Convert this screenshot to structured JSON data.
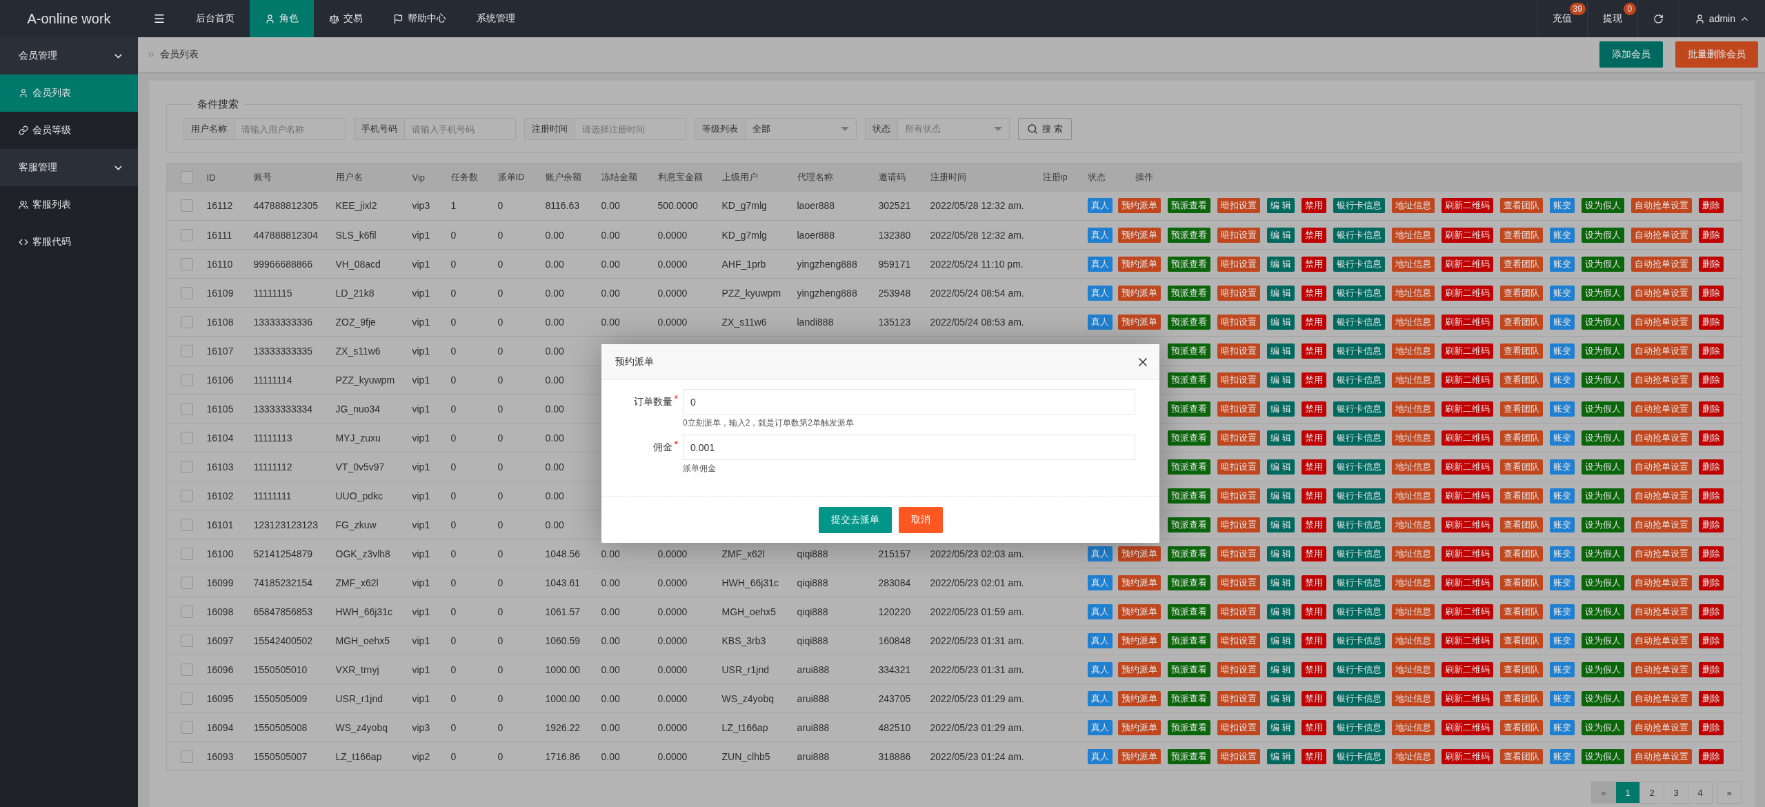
{
  "app": {
    "title": "A-online work"
  },
  "top_nav": [
    {
      "label": "后台首页",
      "selected": false
    },
    {
      "label": "角色",
      "selected": true
    },
    {
      "label": "交易",
      "selected": false
    },
    {
      "label": "帮助中心",
      "selected": false
    },
    {
      "label": "系统管理",
      "selected": false
    }
  ],
  "top_right": [
    {
      "label": "充值",
      "badge": "39"
    },
    {
      "label": "提现",
      "badge": "0"
    }
  ],
  "user": {
    "name": "admin"
  },
  "sidebar": [
    {
      "label": "会员管理",
      "expanded": true,
      "children": [
        {
          "label": "会员列表",
          "selected": true
        },
        {
          "label": "会员等级",
          "selected": false
        }
      ]
    },
    {
      "label": "客服管理",
      "expanded": true,
      "children": [
        {
          "label": "客服列表",
          "selected": false
        },
        {
          "label": "客服代码",
          "selected": false
        }
      ]
    }
  ],
  "breadcrumb": "会员列表",
  "page_actions": [
    {
      "label": "添加会员",
      "kind": "primary"
    },
    {
      "label": "批量删除会员",
      "kind": "danger"
    }
  ],
  "search": {
    "legend": "条件搜索",
    "fields": [
      {
        "label": "用户名称",
        "kind": "input",
        "placeholder": "请输入用户名称"
      },
      {
        "label": "手机号码",
        "kind": "input",
        "placeholder": "请输入手机号码"
      },
      {
        "label": "注册时间",
        "kind": "input",
        "placeholder": "请选择注册时间"
      },
      {
        "label": "等级列表",
        "kind": "select",
        "value": "全部"
      },
      {
        "label": "状态",
        "kind": "select",
        "placeholder": "所有状态"
      }
    ],
    "button": "搜 索"
  },
  "table": {
    "select_all": {
      "checked": false
    },
    "columns": [
      "ID",
      "账号",
      "用户名",
      "Vip",
      "任务数",
      "派单ID",
      "账户余额",
      "冻结金额",
      "利息宝金额",
      "上级用户",
      "代理名称",
      "邀请码",
      "注册时间",
      "注册ip",
      "状态",
      "操作"
    ],
    "rows": [
      {
        "checked": false,
        "cells": [
          "16112",
          "447888812305",
          "KEE_jixl2",
          "vip3",
          "1",
          "0",
          "8116.63",
          "0.00",
          "500.0000",
          "KD_g7mlg",
          "laoer888",
          "302521",
          "2022/05/28 12:32 am."
        ],
        "status": "真人",
        "actions": [
          {
            "label": "预约派单",
            "color": "#c0461e"
          },
          {
            "label": "预派查看",
            "color": "#0b650b"
          },
          {
            "label": "暗扣设置",
            "color": "#c0461e"
          },
          {
            "label": "编 辑",
            "color": "#00695f"
          },
          {
            "label": "禁用",
            "color": "#c00000"
          },
          {
            "label": "银行卡信息",
            "color": "#00695f"
          },
          {
            "label": "地址信息",
            "color": "#c0461e"
          },
          {
            "label": "刷新二维码",
            "color": "#c00000"
          },
          {
            "label": "查看团队",
            "color": "#c0461e"
          },
          {
            "label": "账变",
            "color": "#1f7fd0"
          },
          {
            "label": "设为假人",
            "color": "#0b650b"
          },
          {
            "label": "自动抢单设置",
            "color": "#c0461e"
          },
          {
            "label": "删除",
            "color": "#c00000"
          }
        ]
      },
      {
        "checked": false,
        "cells": [
          "16111",
          "447888812304",
          "SLS_k6fil",
          "vip1",
          "0",
          "0",
          "0.00",
          "0.00",
          "0.0000",
          "KD_g7mlg",
          "laoer888",
          "132380",
          "2022/05/28 12:32 am."
        ],
        "status": "真人",
        "actions": [
          {
            "label": "预约派单",
            "color": "#c0461e"
          },
          {
            "label": "预派查看",
            "color": "#0b650b"
          },
          {
            "label": "暗扣设置",
            "color": "#c0461e"
          },
          {
            "label": "编 辑",
            "color": "#00695f"
          },
          {
            "label": "禁用",
            "color": "#c00000"
          },
          {
            "label": "银行卡信息",
            "color": "#00695f"
          },
          {
            "label": "地址信息",
            "color": "#c0461e"
          },
          {
            "label": "刷新二维码",
            "color": "#c00000"
          },
          {
            "label": "查看团队",
            "color": "#c0461e"
          },
          {
            "label": "账变",
            "color": "#1f7fd0"
          },
          {
            "label": "设为假人",
            "color": "#0b650b"
          },
          {
            "label": "自动抢单设置",
            "color": "#c0461e"
          },
          {
            "label": "删除",
            "color": "#c00000"
          }
        ]
      },
      {
        "checked": false,
        "cells": [
          "16110",
          "99966688866",
          "VH_08acd",
          "vip1",
          "0",
          "0",
          "0.00",
          "0.00",
          "0.0000",
          "AHF_1prb",
          "yingzheng888",
          "959171",
          "2022/05/24 11:10 pm."
        ],
        "status": "真人",
        "actions": [
          {
            "label": "预约派单",
            "color": "#c0461e"
          },
          {
            "label": "预派查看",
            "color": "#0b650b"
          },
          {
            "label": "暗扣设置",
            "color": "#c0461e"
          },
          {
            "label": "编 辑",
            "color": "#00695f"
          },
          {
            "label": "禁用",
            "color": "#c00000"
          },
          {
            "label": "银行卡信息",
            "color": "#00695f"
          },
          {
            "label": "地址信息",
            "color": "#c0461e"
          },
          {
            "label": "刷新二维码",
            "color": "#c00000"
          },
          {
            "label": "查看团队",
            "color": "#c0461e"
          },
          {
            "label": "账变",
            "color": "#1f7fd0"
          },
          {
            "label": "设为假人",
            "color": "#0b650b"
          },
          {
            "label": "自动抢单设置",
            "color": "#c0461e"
          },
          {
            "label": "删除",
            "color": "#c00000"
          }
        ]
      },
      {
        "checked": false,
        "cells": [
          "16109",
          "11111115",
          "LD_21k8",
          "vip1",
          "0",
          "0",
          "0.00",
          "0.00",
          "0.0000",
          "PZZ_kyuwpm",
          "yingzheng888",
          "253948",
          "2022/05/24 08:54 am."
        ],
        "status": "真人",
        "actions": [
          {
            "label": "预约派单",
            "color": "#c0461e"
          },
          {
            "label": "预派查看",
            "color": "#0b650b"
          },
          {
            "label": "暗扣设置",
            "color": "#c0461e"
          },
          {
            "label": "编 辑",
            "color": "#00695f"
          },
          {
            "label": "禁用",
            "color": "#c00000"
          },
          {
            "label": "银行卡信息",
            "color": "#00695f"
          },
          {
            "label": "地址信息",
            "color": "#c0461e"
          },
          {
            "label": "刷新二维码",
            "color": "#c00000"
          },
          {
            "label": "查看团队",
            "color": "#c0461e"
          },
          {
            "label": "账变",
            "color": "#1f7fd0"
          },
          {
            "label": "设为假人",
            "color": "#0b650b"
          },
          {
            "label": "自动抢单设置",
            "color": "#c0461e"
          },
          {
            "label": "删除",
            "color": "#c00000"
          }
        ]
      },
      {
        "checked": false,
        "cells": [
          "16108",
          "13333333336",
          "ZOZ_9fje",
          "vip1",
          "0",
          "0",
          "0.00",
          "0.00",
          "0.0000",
          "ZX_s11w6",
          "landi888",
          "135123",
          "2022/05/24 08:53 am."
        ],
        "status": "真人",
        "actions": [
          {
            "label": "预约派单",
            "color": "#c0461e"
          },
          {
            "label": "预派查看",
            "color": "#0b650b"
          },
          {
            "label": "暗扣设置",
            "color": "#c0461e"
          },
          {
            "label": "编 辑",
            "color": "#00695f"
          },
          {
            "label": "禁用",
            "color": "#c00000"
          },
          {
            "label": "银行卡信息",
            "color": "#00695f"
          },
          {
            "label": "地址信息",
            "color": "#c0461e"
          },
          {
            "label": "刷新二维码",
            "color": "#c00000"
          },
          {
            "label": "查看团队",
            "color": "#c0461e"
          },
          {
            "label": "账变",
            "color": "#1f7fd0"
          },
          {
            "label": "设为假人",
            "color": "#0b650b"
          },
          {
            "label": "自动抢单设置",
            "color": "#c0461e"
          },
          {
            "label": "删除",
            "color": "#c00000"
          }
        ]
      },
      {
        "checked": false,
        "cells": [
          "16107",
          "13333333335",
          "ZX_s11w6",
          "vip1",
          "0",
          "0",
          "0.00"
        ],
        "actions": [
          {
            "label": "预派查看",
            "color": "#0b650b"
          },
          {
            "label": "暗扣设置",
            "color": "#c0461e"
          },
          {
            "label": "编 辑",
            "color": "#00695f"
          },
          {
            "label": "禁用",
            "color": "#c00000"
          },
          {
            "label": "银行卡信息",
            "color": "#00695f"
          },
          {
            "label": "地址信息",
            "color": "#c0461e"
          },
          {
            "label": "刷新二维码",
            "color": "#c00000"
          },
          {
            "label": "查看团队",
            "color": "#c0461e"
          },
          {
            "label": "账变",
            "color": "#1f7fd0"
          },
          {
            "label": "设为假人",
            "color": "#0b650b"
          },
          {
            "label": "自动抢单设置",
            "color": "#c0461e"
          },
          {
            "label": "删除",
            "color": "#c00000"
          }
        ]
      },
      {
        "checked": false,
        "cells": [
          "16106",
          "11111114",
          "PZZ_kyuwpm",
          "vip1",
          "0",
          "0",
          "0.00"
        ],
        "actions": [
          {
            "label": "预派查看",
            "color": "#0b650b"
          },
          {
            "label": "暗扣设置",
            "color": "#c0461e"
          },
          {
            "label": "编 辑",
            "color": "#00695f"
          },
          {
            "label": "禁用",
            "color": "#c00000"
          },
          {
            "label": "银行卡信息",
            "color": "#00695f"
          },
          {
            "label": "地址信息",
            "color": "#c0461e"
          },
          {
            "label": "刷新二维码",
            "color": "#c00000"
          },
          {
            "label": "查看团队",
            "color": "#c0461e"
          },
          {
            "label": "账变",
            "color": "#1f7fd0"
          },
          {
            "label": "设为假人",
            "color": "#0b650b"
          },
          {
            "label": "自动抢单设置",
            "color": "#c0461e"
          },
          {
            "label": "删除",
            "color": "#c00000"
          }
        ]
      },
      {
        "checked": false,
        "cells": [
          "16105",
          "13333333334",
          "JG_nuo34",
          "vip1",
          "0",
          "0",
          "0.00"
        ],
        "actions": [
          {
            "label": "预派查看",
            "color": "#0b650b"
          },
          {
            "label": "暗扣设置",
            "color": "#c0461e"
          },
          {
            "label": "编 辑",
            "color": "#00695f"
          },
          {
            "label": "禁用",
            "color": "#c00000"
          },
          {
            "label": "银行卡信息",
            "color": "#00695f"
          },
          {
            "label": "地址信息",
            "color": "#c0461e"
          },
          {
            "label": "刷新二维码",
            "color": "#c00000"
          },
          {
            "label": "查看团队",
            "color": "#c0461e"
          },
          {
            "label": "账变",
            "color": "#1f7fd0"
          },
          {
            "label": "设为假人",
            "color": "#0b650b"
          },
          {
            "label": "自动抢单设置",
            "color": "#c0461e"
          },
          {
            "label": "删除",
            "color": "#c00000"
          }
        ]
      },
      {
        "checked": false,
        "cells": [
          "16104",
          "11111113",
          "MYJ_zuxu",
          "vip1",
          "0",
          "0",
          "0.00"
        ],
        "actions": [
          {
            "label": "预派查看",
            "color": "#0b650b"
          },
          {
            "label": "暗扣设置",
            "color": "#c0461e"
          },
          {
            "label": "编 辑",
            "color": "#00695f"
          },
          {
            "label": "禁用",
            "color": "#c00000"
          },
          {
            "label": "银行卡信息",
            "color": "#00695f"
          },
          {
            "label": "地址信息",
            "color": "#c0461e"
          },
          {
            "label": "刷新二维码",
            "color": "#c00000"
          },
          {
            "label": "查看团队",
            "color": "#c0461e"
          },
          {
            "label": "账变",
            "color": "#1f7fd0"
          },
          {
            "label": "设为假人",
            "color": "#0b650b"
          },
          {
            "label": "自动抢单设置",
            "color": "#c0461e"
          },
          {
            "label": "删除",
            "color": "#c00000"
          }
        ]
      },
      {
        "checked": false,
        "cells": [
          "16103",
          "11111112",
          "VT_0v5v97",
          "vip1",
          "0",
          "0",
          "0.00"
        ],
        "actions": [
          {
            "label": "预派查看",
            "color": "#0b650b"
          },
          {
            "label": "暗扣设置",
            "color": "#c0461e"
          },
          {
            "label": "编 辑",
            "color": "#00695f"
          },
          {
            "label": "禁用",
            "color": "#c00000"
          },
          {
            "label": "银行卡信息",
            "color": "#00695f"
          },
          {
            "label": "地址信息",
            "color": "#c0461e"
          },
          {
            "label": "刷新二维码",
            "color": "#c00000"
          },
          {
            "label": "查看团队",
            "color": "#c0461e"
          },
          {
            "label": "账变",
            "color": "#1f7fd0"
          },
          {
            "label": "设为假人",
            "color": "#0b650b"
          },
          {
            "label": "自动抢单设置",
            "color": "#c0461e"
          },
          {
            "label": "删除",
            "color": "#c00000"
          }
        ]
      },
      {
        "checked": false,
        "cells": [
          "16102",
          "11111111",
          "UUO_pdkc",
          "vip1",
          "0",
          "0",
          "0.00"
        ],
        "actions": [
          {
            "label": "预派查看",
            "color": "#0b650b"
          },
          {
            "label": "暗扣设置",
            "color": "#c0461e"
          },
          {
            "label": "编 辑",
            "color": "#00695f"
          },
          {
            "label": "禁用",
            "color": "#c00000"
          },
          {
            "label": "银行卡信息",
            "color": "#00695f"
          },
          {
            "label": "地址信息",
            "color": "#c0461e"
          },
          {
            "label": "刷新二维码",
            "color": "#c00000"
          },
          {
            "label": "查看团队",
            "color": "#c0461e"
          },
          {
            "label": "账变",
            "color": "#1f7fd0"
          },
          {
            "label": "设为假人",
            "color": "#0b650b"
          },
          {
            "label": "自动抢单设置",
            "color": "#c0461e"
          },
          {
            "label": "删除",
            "color": "#c00000"
          }
        ]
      },
      {
        "checked": false,
        "cells": [
          "16101",
          "123123123123",
          "FG_zkuw",
          "vip1",
          "0",
          "0",
          "0.00"
        ],
        "actions": [
          {
            "label": "预派查看",
            "color": "#0b650b"
          },
          {
            "label": "暗扣设置",
            "color": "#c0461e"
          },
          {
            "label": "编 辑",
            "color": "#00695f"
          },
          {
            "label": "禁用",
            "color": "#c00000"
          },
          {
            "label": "银行卡信息",
            "color": "#00695f"
          },
          {
            "label": "地址信息",
            "color": "#c0461e"
          },
          {
            "label": "刷新二维码",
            "color": "#c00000"
          },
          {
            "label": "查看团队",
            "color": "#c0461e"
          },
          {
            "label": "账变",
            "color": "#1f7fd0"
          },
          {
            "label": "设为假人",
            "color": "#0b650b"
          },
          {
            "label": "自动抢单设置",
            "color": "#c0461e"
          },
          {
            "label": "删除",
            "color": "#c00000"
          }
        ]
      },
      {
        "checked": false,
        "cells": [
          "16100",
          "52141254879",
          "OGK_z3vlh8",
          "vip1",
          "0",
          "0",
          "1048.56",
          "0.00",
          "0.0000",
          "ZMF_x62l",
          "qiqi888",
          "215157",
          "2022/05/23 02:03 am."
        ],
        "status": "真人",
        "actions": [
          {
            "label": "预约派单",
            "color": "#c0461e"
          },
          {
            "label": "预派查看",
            "color": "#0b650b"
          },
          {
            "label": "暗扣设置",
            "color": "#c0461e"
          },
          {
            "label": "编 辑",
            "color": "#00695f"
          },
          {
            "label": "禁用",
            "color": "#c00000"
          },
          {
            "label": "银行卡信息",
            "color": "#00695f"
          },
          {
            "label": "地址信息",
            "color": "#c0461e"
          },
          {
            "label": "刷新二维码",
            "color": "#c00000"
          },
          {
            "label": "查看团队",
            "color": "#c0461e"
          },
          {
            "label": "账变",
            "color": "#1f7fd0"
          },
          {
            "label": "设为假人",
            "color": "#0b650b"
          },
          {
            "label": "自动抢单设置",
            "color": "#c0461e"
          },
          {
            "label": "删除",
            "color": "#c00000"
          }
        ]
      },
      {
        "checked": false,
        "cells": [
          "16099",
          "74185232154",
          "ZMF_x62l",
          "vip1",
          "0",
          "0",
          "1043.61",
          "0.00",
          "0.0000",
          "HWH_66j31c",
          "qiqi888",
          "283084",
          "2022/05/23 02:01 am."
        ],
        "status": "真人",
        "actions": [
          {
            "label": "预约派单",
            "color": "#c0461e"
          },
          {
            "label": "预派查看",
            "color": "#0b650b"
          },
          {
            "label": "暗扣设置",
            "color": "#c0461e"
          },
          {
            "label": "编 辑",
            "color": "#00695f"
          },
          {
            "label": "禁用",
            "color": "#c00000"
          },
          {
            "label": "银行卡信息",
            "color": "#00695f"
          },
          {
            "label": "地址信息",
            "color": "#c0461e"
          },
          {
            "label": "刷新二维码",
            "color": "#c00000"
          },
          {
            "label": "查看团队",
            "color": "#c0461e"
          },
          {
            "label": "账变",
            "color": "#1f7fd0"
          },
          {
            "label": "设为假人",
            "color": "#0b650b"
          },
          {
            "label": "自动抢单设置",
            "color": "#c0461e"
          },
          {
            "label": "删除",
            "color": "#c00000"
          }
        ]
      },
      {
        "checked": false,
        "cells": [
          "16098",
          "65847856853",
          "HWH_66j31c",
          "vip1",
          "0",
          "0",
          "1061.57",
          "0.00",
          "0.0000",
          "MGH_oehx5",
          "qiqi888",
          "120220",
          "2022/05/23 01:59 am."
        ],
        "status": "真人",
        "actions": [
          {
            "label": "预约派单",
            "color": "#c0461e"
          },
          {
            "label": "预派查看",
            "color": "#0b650b"
          },
          {
            "label": "暗扣设置",
            "color": "#c0461e"
          },
          {
            "label": "编 辑",
            "color": "#00695f"
          },
          {
            "label": "禁用",
            "color": "#c00000"
          },
          {
            "label": "银行卡信息",
            "color": "#00695f"
          },
          {
            "label": "地址信息",
            "color": "#c0461e"
          },
          {
            "label": "刷新二维码",
            "color": "#c00000"
          },
          {
            "label": "查看团队",
            "color": "#c0461e"
          },
          {
            "label": "账变",
            "color": "#1f7fd0"
          },
          {
            "label": "设为假人",
            "color": "#0b650b"
          },
          {
            "label": "自动抢单设置",
            "color": "#c0461e"
          },
          {
            "label": "删除",
            "color": "#c00000"
          }
        ]
      },
      {
        "checked": false,
        "cells": [
          "16097",
          "15542400502",
          "MGH_oehx5",
          "vip1",
          "0",
          "0",
          "1060.59",
          "0.00",
          "0.0000",
          "KBS_3rb3",
          "qiqi888",
          "160848",
          "2022/05/23 01:31 am."
        ],
        "status": "真人",
        "actions": [
          {
            "label": "预约派单",
            "color": "#c0461e"
          },
          {
            "label": "预派查看",
            "color": "#0b650b"
          },
          {
            "label": "暗扣设置",
            "color": "#c0461e"
          },
          {
            "label": "编 辑",
            "color": "#00695f"
          },
          {
            "label": "禁用",
            "color": "#c00000"
          },
          {
            "label": "银行卡信息",
            "color": "#00695f"
          },
          {
            "label": "地址信息",
            "color": "#c0461e"
          },
          {
            "label": "刷新二维码",
            "color": "#c00000"
          },
          {
            "label": "查看团队",
            "color": "#c0461e"
          },
          {
            "label": "账变",
            "color": "#1f7fd0"
          },
          {
            "label": "设为假人",
            "color": "#0b650b"
          },
          {
            "label": "自动抢单设置",
            "color": "#c0461e"
          },
          {
            "label": "删除",
            "color": "#c00000"
          }
        ]
      },
      {
        "checked": false,
        "cells": [
          "16096",
          "1550505010",
          "VXR_trnyj",
          "vip1",
          "0",
          "0",
          "1000.00",
          "0.00",
          "0.0000",
          "USR_r1jnd",
          "arui888",
          "334321",
          "2022/05/23 01:31 am."
        ],
        "status": "真人",
        "actions": [
          {
            "label": "预约派单",
            "color": "#c0461e"
          },
          {
            "label": "预派查看",
            "color": "#0b650b"
          },
          {
            "label": "暗扣设置",
            "color": "#c0461e"
          },
          {
            "label": "编 辑",
            "color": "#00695f"
          },
          {
            "label": "禁用",
            "color": "#c00000"
          },
          {
            "label": "银行卡信息",
            "color": "#00695f"
          },
          {
            "label": "地址信息",
            "color": "#c0461e"
          },
          {
            "label": "刷新二维码",
            "color": "#c00000"
          },
          {
            "label": "查看团队",
            "color": "#c0461e"
          },
          {
            "label": "账变",
            "color": "#1f7fd0"
          },
          {
            "label": "设为假人",
            "color": "#0b650b"
          },
          {
            "label": "自动抢单设置",
            "color": "#c0461e"
          },
          {
            "label": "删除",
            "color": "#c00000"
          }
        ]
      },
      {
        "checked": false,
        "cells": [
          "16095",
          "1550505009",
          "USR_r1jnd",
          "vip1",
          "0",
          "0",
          "1000.00",
          "0.00",
          "0.0000",
          "WS_z4yobq",
          "arui888",
          "243705",
          "2022/05/23 01:29 am."
        ],
        "status": "真人",
        "actions": [
          {
            "label": "预约派单",
            "color": "#c0461e"
          },
          {
            "label": "预派查看",
            "color": "#0b650b"
          },
          {
            "label": "暗扣设置",
            "color": "#c0461e"
          },
          {
            "label": "编 辑",
            "color": "#00695f"
          },
          {
            "label": "禁用",
            "color": "#c00000"
          },
          {
            "label": "银行卡信息",
            "color": "#00695f"
          },
          {
            "label": "地址信息",
            "color": "#c0461e"
          },
          {
            "label": "刷新二维码",
            "color": "#c00000"
          },
          {
            "label": "查看团队",
            "color": "#c0461e"
          },
          {
            "label": "账变",
            "color": "#1f7fd0"
          },
          {
            "label": "设为假人",
            "color": "#0b650b"
          },
          {
            "label": "自动抢单设置",
            "color": "#c0461e"
          },
          {
            "label": "删除",
            "color": "#c00000"
          }
        ]
      },
      {
        "checked": false,
        "cells": [
          "16094",
          "1550505008",
          "WS_z4yobq",
          "vip3",
          "0",
          "0",
          "1926.22",
          "0.00",
          "0.0000",
          "LZ_t166ap",
          "arui888",
          "482510",
          "2022/05/23 01:29 am."
        ],
        "status": "真人",
        "actions": [
          {
            "label": "预约派单",
            "color": "#c0461e"
          },
          {
            "label": "预派查看",
            "color": "#0b650b"
          },
          {
            "label": "暗扣设置",
            "color": "#c0461e"
          },
          {
            "label": "编 辑",
            "color": "#00695f"
          },
          {
            "label": "禁用",
            "color": "#c00000"
          },
          {
            "label": "银行卡信息",
            "color": "#00695f"
          },
          {
            "label": "地址信息",
            "color": "#c0461e"
          },
          {
            "label": "刷新二维码",
            "color": "#c00000"
          },
          {
            "label": "查看团队",
            "color": "#c0461e"
          },
          {
            "label": "账变",
            "color": "#1f7fd0"
          },
          {
            "label": "设为假人",
            "color": "#0b650b"
          },
          {
            "label": "自动抢单设置",
            "color": "#c0461e"
          },
          {
            "label": "删除",
            "color": "#c00000"
          }
        ]
      },
      {
        "checked": false,
        "cells": [
          "16093",
          "1550505007",
          "LZ_t166ap",
          "vip2",
          "0",
          "0",
          "1716.86",
          "0.00",
          "0.0000",
          "ZUN_clhb5",
          "arui888",
          "318886",
          "2022/05/23 01:24 am."
        ],
        "status": "真人",
        "actions": [
          {
            "label": "预约派单",
            "color": "#c0461e"
          },
          {
            "label": "预派查看",
            "color": "#0b650b"
          },
          {
            "label": "暗扣设置",
            "color": "#c0461e"
          },
          {
            "label": "编 辑",
            "color": "#00695f"
          },
          {
            "label": "禁用",
            "color": "#c00000"
          },
          {
            "label": "银行卡信息",
            "color": "#00695f"
          },
          {
            "label": "地址信息",
            "color": "#c0461e"
          },
          {
            "label": "刷新二维码",
            "color": "#c00000"
          },
          {
            "label": "查看团队",
            "color": "#c0461e"
          },
          {
            "label": "账变",
            "color": "#1f7fd0"
          },
          {
            "label": "设为假人",
            "color": "#0b650b"
          },
          {
            "label": "自动抢单设置",
            "color": "#c0461e"
          },
          {
            "label": "删除",
            "color": "#c00000"
          }
        ]
      }
    ]
  },
  "pagination": {
    "prev": {
      "label": "«",
      "disabled": true
    },
    "pages": [
      {
        "label": "1",
        "selected": true
      },
      {
        "label": "2",
        "selected": false
      },
      {
        "label": "3",
        "selected": false
      },
      {
        "label": "4",
        "selected": false
      }
    ],
    "next": {
      "label": "»",
      "disabled": false
    }
  },
  "dialog": {
    "title": "预约派单",
    "fields": [
      {
        "label": "订单数量",
        "required_mark": "*",
        "value": "0",
        "hint": "0立刻派单，输入2，就是订单数第2单触发派单"
      },
      {
        "label": "佣金",
        "required_mark": "*",
        "value": "0.001",
        "hint": "派单佣金"
      }
    ],
    "buttons": [
      {
        "label": "提交去派单",
        "kind": "primary"
      },
      {
        "label": "取消",
        "kind": "danger"
      }
    ]
  }
}
